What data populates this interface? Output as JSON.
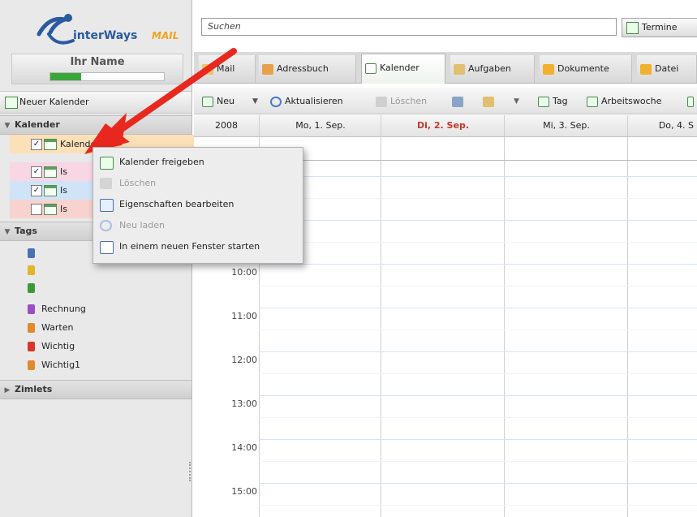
{
  "app": {
    "logo_word": "interWays",
    "logo_mail": "MAIL",
    "username": "Ihr Name",
    "quota_percent": 27
  },
  "search": {
    "placeholder": "Suchen"
  },
  "search_scope": {
    "label": "Termine"
  },
  "sidebar": {
    "new_calendar_label": "Neuer Kalender",
    "calendars_header": "Kalender",
    "calendars": [
      {
        "label": "Kalender",
        "checked": true,
        "color": "#fde0b8"
      },
      {
        "label": "Is",
        "checked": true,
        "color": "#f9d6e4"
      },
      {
        "label": "Is",
        "checked": true,
        "color": "#cfe4f7"
      },
      {
        "label": "Is",
        "checked": false,
        "color": "#f7d2cf"
      }
    ],
    "tags_header": "Tags",
    "tags": [
      {
        "label": "Rechnung",
        "color": "#9a4fc8"
      },
      {
        "label": "Warten",
        "color": "#e08a2a"
      },
      {
        "label": "Wichtig",
        "color": "#d8352a"
      },
      {
        "label": "Wichtig1",
        "color": "#e08a2a"
      }
    ],
    "zimlets_header": "Zimlets"
  },
  "tabs": [
    {
      "label": "Mail"
    },
    {
      "label": "Adressbuch"
    },
    {
      "label": "Kalender"
    },
    {
      "label": "Aufgaben"
    },
    {
      "label": "Dokumente"
    },
    {
      "label": "Datei"
    }
  ],
  "toolbar": {
    "new_label": "Neu",
    "refresh_label": "Aktualisieren",
    "delete_label": "Löschen",
    "day_label": "Tag",
    "workweek_label": "Arbeitswoche"
  },
  "calendar": {
    "year": "2008",
    "days": [
      "Mo, 1. Sep.",
      "Di, 2. Sep.",
      "Mi, 3. Sep.",
      "Do, 4. S"
    ],
    "today_color": "#c0392b",
    "times": [
      "10:00",
      "11:00",
      "12:00",
      "13:00",
      "14:00",
      "15:00"
    ]
  },
  "context_menu": {
    "items": [
      {
        "label": "Kalender freigeben",
        "enabled": true,
        "icon": "calendar-share-icon"
      },
      {
        "label": "Löschen",
        "enabled": false,
        "icon": "trash-icon"
      },
      {
        "label": "Eigenschaften bearbeiten",
        "enabled": true,
        "icon": "properties-icon"
      },
      {
        "label": "Neu laden",
        "enabled": false,
        "icon": "reload-icon"
      },
      {
        "label": "In einem neuen Fenster starten",
        "enabled": true,
        "icon": "new-window-icon"
      }
    ]
  },
  "colors": {
    "accent_green": "#3aa63a",
    "arrow_red": "#e8281e"
  }
}
